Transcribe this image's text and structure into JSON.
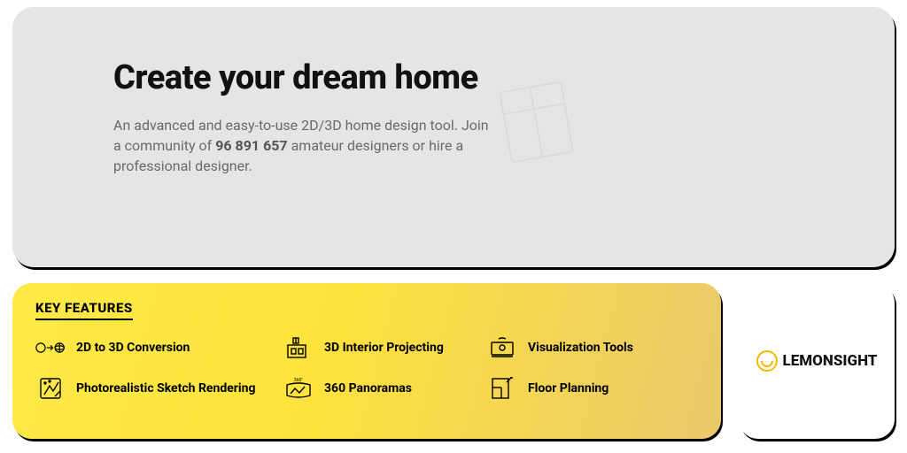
{
  "hero": {
    "title": "Create your dream home",
    "subtitle_pre": "An advanced and easy-to-use 2D/3D home design tool. Join a community of ",
    "subtitle_bold": "96 891 657",
    "subtitle_post": " amateur designers or hire a professional designer."
  },
  "features": {
    "heading": "KEY FEATURES",
    "items": [
      {
        "label": "2D to 3D Conversion"
      },
      {
        "label": "3D Interior Projecting"
      },
      {
        "label": "Visualization Tools"
      },
      {
        "label": "Photorealistic Sketch Rendering"
      },
      {
        "label": "360 Panoramas"
      },
      {
        "label": "Floor Planning"
      }
    ]
  },
  "brand": {
    "name": "LEMONSIGHT"
  }
}
